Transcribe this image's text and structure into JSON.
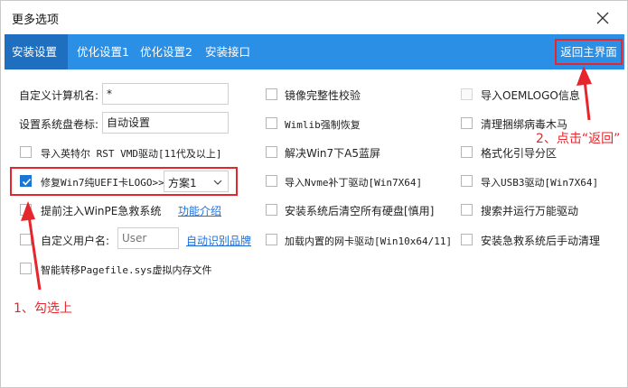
{
  "window": {
    "title": "更多选项"
  },
  "tabs": [
    {
      "label": "安装设置",
      "active": true
    },
    {
      "label": "优化设置1"
    },
    {
      "label": "优化设置2"
    },
    {
      "label": "安装接口"
    }
  ],
  "return_button": {
    "label": "返回主界面"
  },
  "fields": {
    "computer_name": {
      "label": "自定义计算机名:",
      "value": "*"
    },
    "volume_label": {
      "label": "设置系统盘卷标:",
      "value": "自动设置"
    },
    "username": {
      "label": "自定义用户名:",
      "placeholder": "User"
    }
  },
  "col1": {
    "intel_rst": {
      "label": "导入英特尔 RST VMD驱动[11代及以上]",
      "checked": false
    },
    "win7_uefi": {
      "label": "修复Win7纯UEFI卡LOGO>>",
      "checked": true
    },
    "scheme_select": {
      "value": "方案1"
    },
    "winpe": {
      "label": "提前注入WinPE急救系统",
      "checked": false
    },
    "winpe_link": "功能介绍",
    "username_cb": {
      "checked": false
    },
    "auto_brand_link": "自动识别品牌",
    "pagefile": {
      "label": "智能转移Pagefile.sys虚拟内存文件",
      "checked": false
    }
  },
  "col2": {
    "image_verify": {
      "label": "镜像完整性校验",
      "checked": false
    },
    "wimlib": {
      "label": "Wimlib强制恢复",
      "checked": false
    },
    "win7_a5": {
      "label": "解决Win7下A5蓝屏",
      "checked": false
    },
    "nvme": {
      "label": "导入Nvme补丁驱动[Win7X64]",
      "checked": false
    },
    "clear_disks": {
      "label": "安装系统后清空所有硬盘[慎用]",
      "checked": false
    },
    "nic_driver": {
      "label": "加载内置的网卡驱动[Win10x64/11]",
      "checked": false
    }
  },
  "col3": {
    "oemlogo": {
      "label": "导入OEMLOGO信息",
      "checked": false,
      "disabled": true
    },
    "trojan": {
      "label": "清理捆绑病毒木马",
      "checked": false
    },
    "format_boot": {
      "label": "格式化引导分区",
      "checked": false
    },
    "usb3": {
      "label": "导入USB3驱动[Win7X64]",
      "checked": false
    },
    "universal_driver": {
      "label": "搜索并运行万能驱动",
      "checked": false
    },
    "rescue_cleanup": {
      "label": "安装急救系统后手动清理",
      "checked": false
    }
  },
  "annotations": {
    "step1": "1、勾选上",
    "step2": "2、点击“返回”"
  },
  "colors": {
    "accent": "#2b8fe6",
    "active_tab": "#1f6fc0",
    "annotation": "#e5262c",
    "link": "#1e6fd9"
  }
}
